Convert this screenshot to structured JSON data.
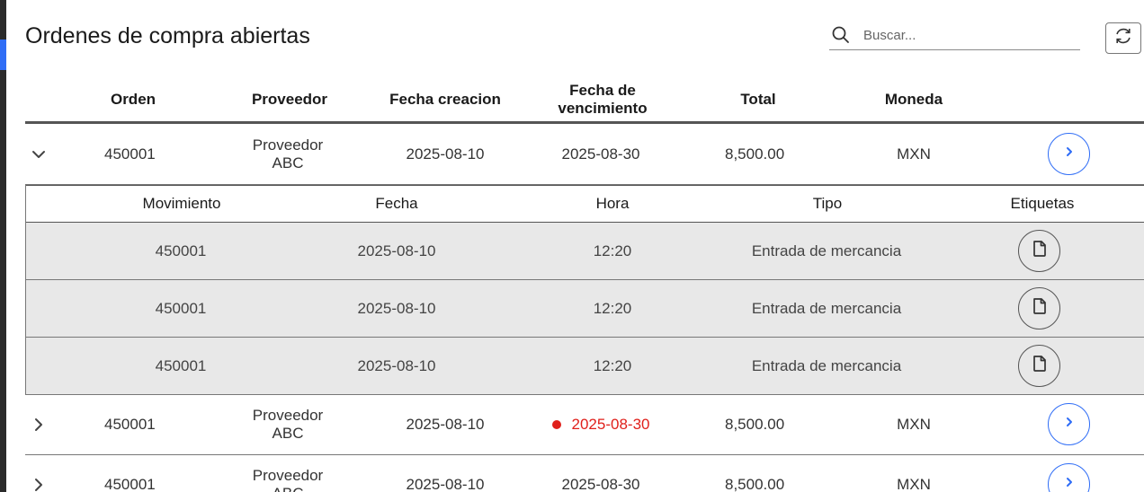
{
  "page": {
    "title": "Ordenes de compra abiertas"
  },
  "search": {
    "placeholder": "Buscar...",
    "value": "",
    "icon": "search-icon"
  },
  "toolbar": {
    "refresh_icon": "refresh-icon"
  },
  "columns": [
    "Orden",
    "Proveedor",
    "Fecha creacion",
    "Fecha de vencimiento",
    "Total",
    "Moneda"
  ],
  "orders": [
    {
      "expanded": true,
      "orden": "450001",
      "proveedor": "Proveedor ABC",
      "fecha_creacion": "2025-08-10",
      "fecha_vencimiento": "2025-08-30",
      "overdue": false,
      "total": "8,500.00",
      "moneda": "MXN"
    },
    {
      "expanded": false,
      "orden": "450001",
      "proveedor": "Proveedor ABC",
      "fecha_creacion": "2025-08-10",
      "fecha_vencimiento": "2025-08-30",
      "overdue": true,
      "total": "8,500.00",
      "moneda": "MXN"
    },
    {
      "expanded": false,
      "orden": "450001",
      "proveedor": "Proveedor ABC",
      "fecha_creacion": "2025-08-10",
      "fecha_vencimiento": "2025-08-30",
      "overdue": false,
      "total": "8,500.00",
      "moneda": "MXN"
    }
  ],
  "movements": {
    "columns": [
      "Movimiento",
      "Fecha",
      "Hora",
      "Tipo",
      "Etiquetas"
    ],
    "rows": [
      {
        "movimiento": "450001",
        "fecha": "2025-08-10",
        "hora": "12:20",
        "tipo": "Entrada de mercancia"
      },
      {
        "movimiento": "450001",
        "fecha": "2025-08-10",
        "hora": "12:20",
        "tipo": "Entrada de mercancia"
      },
      {
        "movimiento": "450001",
        "fecha": "2025-08-10",
        "hora": "12:20",
        "tipo": "Entrada de mercancia"
      }
    ]
  },
  "colors": {
    "accent": "#2f6df6",
    "overdue": "#e0201b",
    "subtable_bg": "#e8e8e8"
  }
}
